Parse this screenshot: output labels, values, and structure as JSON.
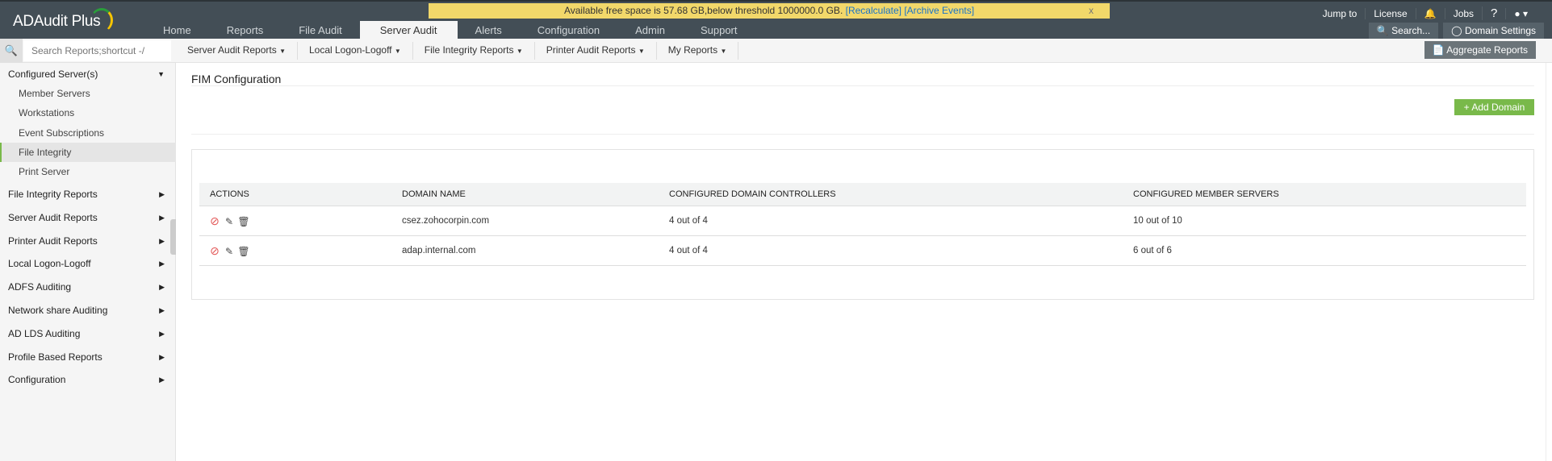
{
  "app": {
    "name": "ADAudit Plus"
  },
  "banner": {
    "text": "Available free space is 57.68 GB,below threshold 1000000.0 GB.",
    "recalculate": "[Recalculate]",
    "archive": "[Archive Events]",
    "close": "x"
  },
  "tabs": [
    "Home",
    "Reports",
    "File Audit",
    "Server Audit",
    "Alerts",
    "Configuration",
    "Admin",
    "Support"
  ],
  "active_tab": "Server Audit",
  "top_right": {
    "jump_to": "Jump to",
    "license": "License",
    "jobs": "Jobs",
    "help": "?",
    "search": "Search...",
    "domain_settings": "Domain Settings"
  },
  "search": {
    "placeholder": "Search Reports;shortcut -/"
  },
  "submenu": [
    "Server Audit Reports",
    "Local Logon-Logoff",
    "File Integrity Reports",
    "Printer Audit Reports",
    "My Reports"
  ],
  "aggregate": "Aggregate Reports",
  "sidebar": {
    "configured": "Configured Server(s)",
    "sub_items": [
      "Member Servers",
      "Workstations",
      "Event Subscriptions",
      "File Integrity",
      "Print Server"
    ],
    "selected": "File Integrity",
    "sections": [
      "File Integrity Reports",
      "Server Audit Reports",
      "Printer Audit Reports",
      "Local Logon-Logoff",
      "ADFS Auditing",
      "Network share Auditing",
      "AD LDS Auditing",
      "Profile Based Reports",
      "Configuration"
    ]
  },
  "main": {
    "title": "FIM Configuration",
    "add_domain": "Add Domain",
    "columns": [
      "ACTIONS",
      "DOMAIN NAME",
      "CONFIGURED DOMAIN CONTROLLERS",
      "CONFIGURED MEMBER SERVERS"
    ],
    "rows": [
      {
        "domain": "csez.zohocorpin.com",
        "dcs": "4 out of 4",
        "members": "10 out of 10"
      },
      {
        "domain": "adap.internal.com",
        "dcs": "4 out of 4",
        "members": "6 out of 6"
      }
    ]
  },
  "colors": {
    "topbar": "#434e56",
    "accent_green": "#79b94a",
    "banner": "#f2d86a",
    "disable_icon": "#e25555"
  }
}
